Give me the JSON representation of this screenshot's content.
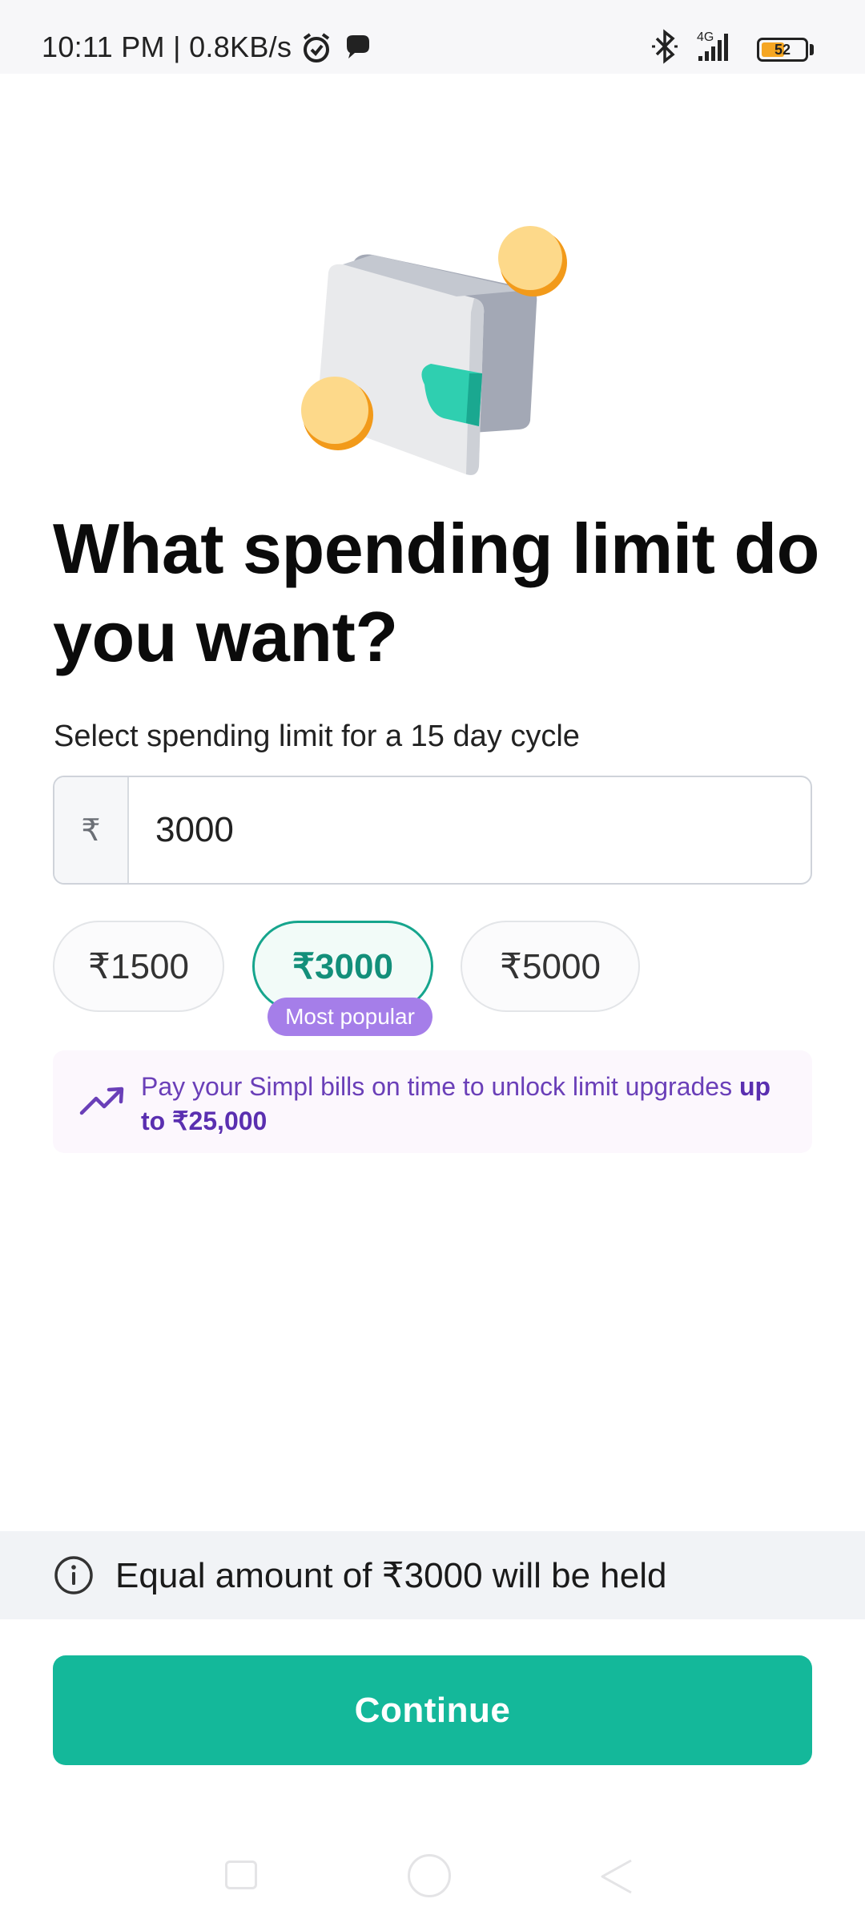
{
  "status_bar": {
    "time": "10:11 PM | 0.8KB/s",
    "network": "4G",
    "battery": "52",
    "icons": [
      "alarm-icon",
      "chat-bubble-icon",
      "bluetooth-icon",
      "signal-icon",
      "battery-icon"
    ]
  },
  "illustration": "wallet-with-coins-icon",
  "title": "What spending limit do you want?",
  "subtitle": "Select spending limit for a 15 day cycle",
  "amount_field": {
    "currency_symbol": "₹",
    "value": "3000"
  },
  "chips": [
    {
      "label": "₹1500",
      "selected": false
    },
    {
      "label": "₹3000",
      "selected": true
    },
    {
      "label": "₹5000",
      "selected": false
    }
  ],
  "popular_badge": "Most popular",
  "upgrade_banner": {
    "icon": "trending-up-icon",
    "text": "Pay your Simpl bills on time to unlock limit upgrades ",
    "bold": "up to ₹25,000"
  },
  "hold_notice": {
    "icon": "info-icon",
    "text": "Equal amount of ₹3000 will be held"
  },
  "continue_label": "Continue",
  "colors": {
    "accent": "#14b89a",
    "selected_chip_border": "#16a58d",
    "badge": "#a57ee9",
    "banner_text": "#6a3fb8"
  }
}
